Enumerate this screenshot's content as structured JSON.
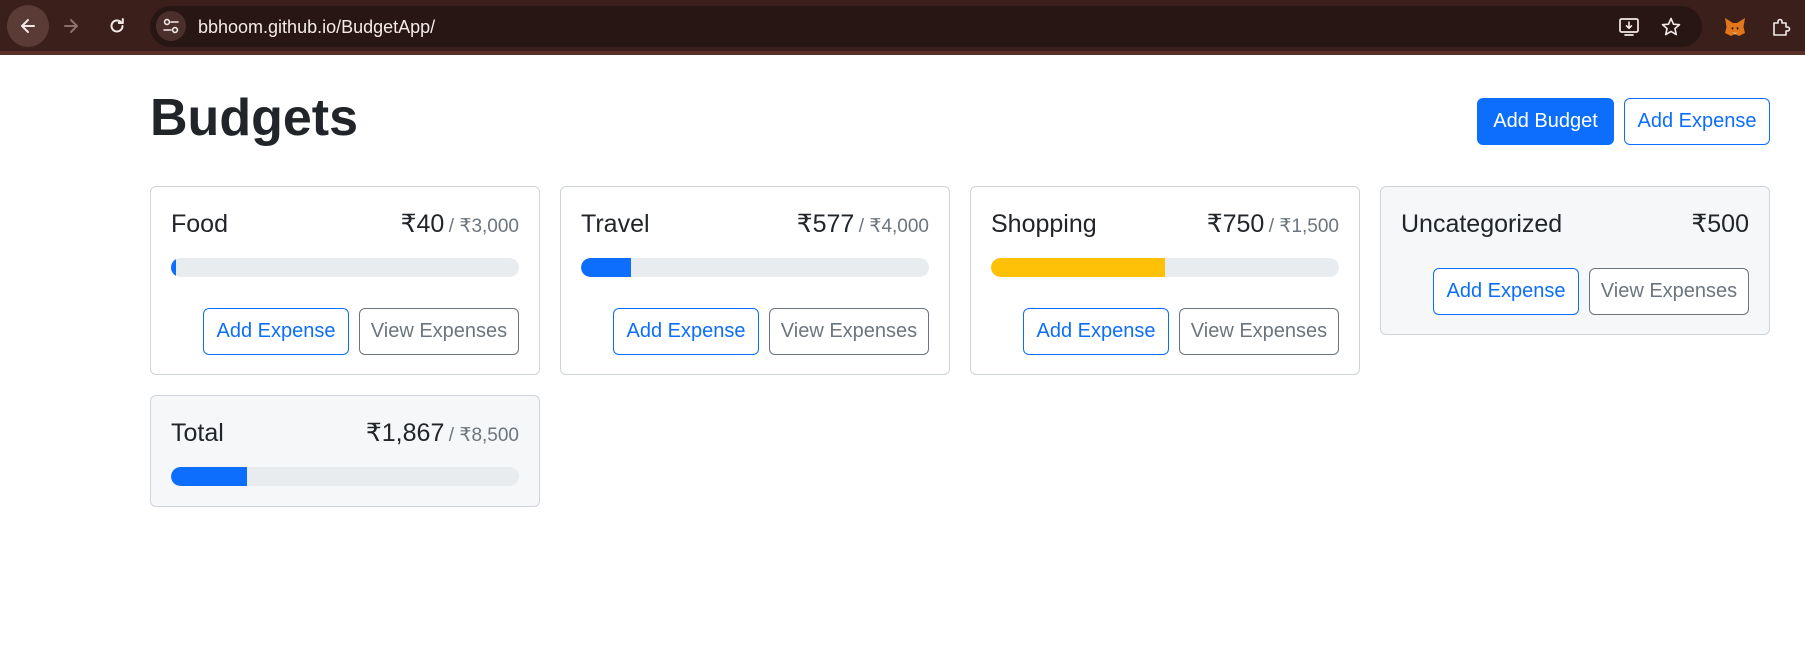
{
  "browser": {
    "url": "bbhoom.github.io/BudgetApp/",
    "icons": {
      "back": "arrow-left-icon",
      "forward": "arrow-right-icon",
      "reload": "reload-icon",
      "site_info": "tune-icon",
      "install": "install-app-icon",
      "bookmark": "star-icon",
      "extension_fox": "metamask-fox-icon",
      "extensions": "puzzle-icon"
    }
  },
  "page": {
    "title": "Budgets",
    "add_budget_label": "Add Budget",
    "add_expense_label": "Add Expense"
  },
  "colors": {
    "primary": "#0d6efd",
    "warning": "#ffc107",
    "secondary": "#6c757d",
    "track": "#e9ecef"
  },
  "budgets": [
    {
      "name": "Food",
      "spent": "₹40",
      "limit": "/ ₹3,000",
      "progress_fraction": 0.0133,
      "progress_color": "#0d6efd",
      "add_label": "Add Expense",
      "view_label": "View Expenses"
    },
    {
      "name": "Travel",
      "spent": "₹577",
      "limit": "/ ₹4,000",
      "progress_fraction": 0.1443,
      "progress_color": "#0d6efd",
      "add_label": "Add Expense",
      "view_label": "View Expenses"
    },
    {
      "name": "Shopping",
      "spent": "₹750",
      "limit": "/ ₹1,500",
      "progress_fraction": 0.5,
      "progress_color": "#ffc107",
      "add_label": "Add Expense",
      "view_label": "View Expenses"
    }
  ],
  "uncategorized": {
    "name": "Uncategorized",
    "spent": "₹500",
    "add_label": "Add Expense",
    "view_label": "View Expenses"
  },
  "total": {
    "name": "Total",
    "spent": "₹1,867",
    "limit": "/ ₹8,500",
    "progress_fraction": 0.2196,
    "progress_color": "#0d6efd"
  }
}
